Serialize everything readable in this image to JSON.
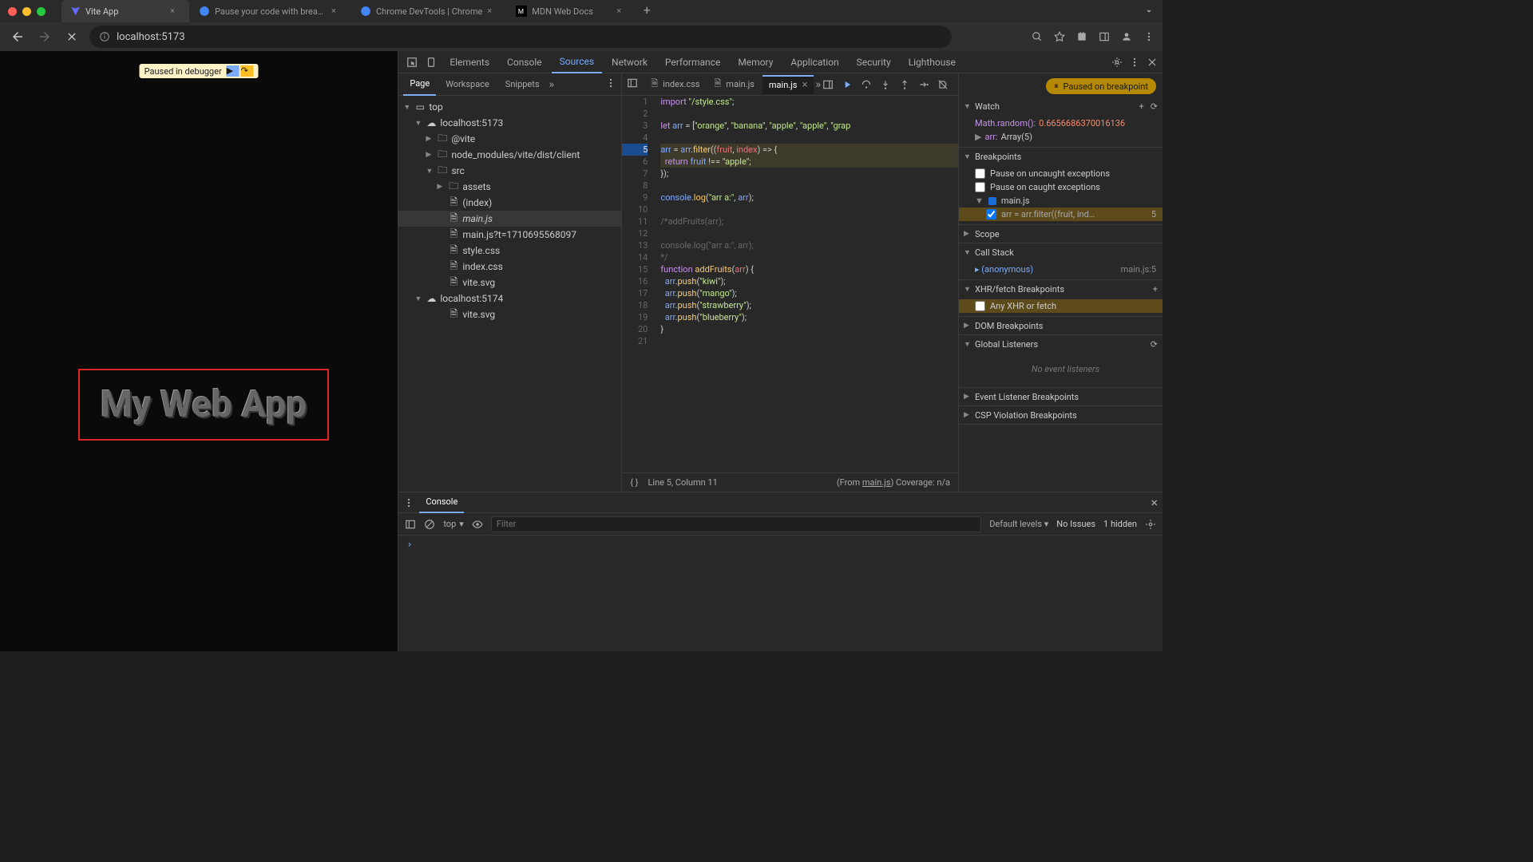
{
  "browser": {
    "tabs": [
      {
        "title": "Vite App",
        "icon": "V"
      },
      {
        "title": "Pause your code with breakp",
        "icon": "C"
      },
      {
        "title": "Chrome DevTools | Chrome",
        "icon": "C"
      },
      {
        "title": "MDN Web Docs",
        "icon": "M"
      }
    ],
    "url": "localhost:5173"
  },
  "viewport": {
    "paused_label": "Paused in debugger",
    "app_heading": "My Web App"
  },
  "devtools": {
    "tabs": [
      "Elements",
      "Console",
      "Sources",
      "Network",
      "Performance",
      "Memory",
      "Application",
      "Security",
      "Lighthouse"
    ],
    "active_tab": "Sources",
    "sources": {
      "subtabs": [
        "Page",
        "Workspace",
        "Snippets"
      ],
      "active_subtab": "Page",
      "tree": {
        "top": "top",
        "host1": "localhost:5173",
        "vite": "@vite",
        "node_modules": "node_modules/vite/dist/client",
        "src": "src",
        "assets": "assets",
        "index": "(index)",
        "main": "main.js",
        "maints": "main.js?t=1710695568097",
        "style": "style.css",
        "indexcss": "index.css",
        "vitesvg": "vite.svg",
        "host2": "localhost:5174",
        "vitesvg2": "vite.svg"
      }
    },
    "editor": {
      "tabs": [
        {
          "name": "index.css"
        },
        {
          "name": "main.js"
        },
        {
          "name": "main.js",
          "active": true
        }
      ],
      "lines": [
        {
          "n": 1,
          "html": "<span class='tk-keyword'>import</span> <span class='tk-string'>\"/style.css\"</span>;"
        },
        {
          "n": 2,
          "html": ""
        },
        {
          "n": 3,
          "html": "<span class='tk-keyword'>let</span> <span class='tk-var'>arr</span> = [<span class='tk-string'>\"orange\"</span>, <span class='tk-string'>\"banana\"</span>, <span class='tk-string'>\"apple\"</span>, <span class='tk-string'>\"apple\"</span>, <span class='tk-string'>\"grap</span>"
        },
        {
          "n": 4,
          "html": ""
        },
        {
          "n": 5,
          "html": "<span class='tk-var'>arr</span> = <span class='tk-var'>arr</span>.<span class='tk-func'>filter</span>((<span class='tk-id'>fruit</span>, <span class='tk-id'>index</span>) =&gt; {",
          "bp": true,
          "hl": true
        },
        {
          "n": 6,
          "html": "  <span class='tk-keyword'>return</span> <span class='tk-var'>fruit</span> !== <span class='tk-string'>\"apple\"</span>;",
          "hl": true
        },
        {
          "n": 7,
          "html": "});"
        },
        {
          "n": 8,
          "html": ""
        },
        {
          "n": 9,
          "html": "<span class='tk-var'>console</span>.<span class='tk-func'>log</span>(<span class='tk-string'>\"arr a:\"</span>, <span class='tk-var'>arr</span>);"
        },
        {
          "n": 10,
          "html": ""
        },
        {
          "n": 11,
          "html": "<span class='tk-comment'>/*addFruits(arr);</span>"
        },
        {
          "n": 12,
          "html": ""
        },
        {
          "n": 13,
          "html": "<span class='tk-comment'>console.log(\"arr a:\", arr);</span>"
        },
        {
          "n": 14,
          "html": "<span class='tk-comment'>*/</span>"
        },
        {
          "n": 15,
          "html": "<span class='tk-keyword'>function</span> <span class='tk-func'>addFruits</span>(<span class='tk-id'>arr</span>) {"
        },
        {
          "n": 16,
          "html": "  <span class='tk-var'>arr</span>.<span class='tk-func'>push</span>(<span class='tk-string'>\"kiwi\"</span>);"
        },
        {
          "n": 17,
          "html": "  <span class='tk-var'>arr</span>.<span class='tk-func'>push</span>(<span class='tk-string'>\"mango\"</span>);"
        },
        {
          "n": 18,
          "html": "  <span class='tk-var'>arr</span>.<span class='tk-func'>push</span>(<span class='tk-string'>\"strawberry\"</span>);"
        },
        {
          "n": 19,
          "html": "  <span class='tk-var'>arr</span>.<span class='tk-func'>push</span>(<span class='tk-string'>\"blueberry\"</span>);"
        },
        {
          "n": 20,
          "html": "}"
        },
        {
          "n": 21,
          "html": ""
        }
      ],
      "status_pos": "Line 5, Column 11",
      "status_from": "(From ",
      "status_file": "main.js",
      "status_coverage": ") Coverage: n/a"
    },
    "debugger": {
      "paused_banner": "Paused on breakpoint",
      "watch_title": "Watch",
      "watch": [
        {
          "name": "Math.random()",
          "val": "0.6656686370016136",
          "type": "num"
        },
        {
          "name": "arr",
          "val": "Array(5)",
          "type": "arr"
        }
      ],
      "breakpoints_title": "Breakpoints",
      "bp_uncaught": "Pause on uncaught exceptions",
      "bp_caught": "Pause on caught exceptions",
      "bp_file": "main.js",
      "bp_code": "arr = arr.filter((fruit, ind…",
      "bp_line": "5",
      "scope_title": "Scope",
      "callstack_title": "Call Stack",
      "stack": [
        {
          "fn": "(anonymous)",
          "loc": "main.js:5"
        }
      ],
      "xhr_title": "XHR/fetch Breakpoints",
      "xhr_any": "Any XHR or fetch",
      "dom_title": "DOM Breakpoints",
      "global_title": "Global Listeners",
      "no_listeners": "No event listeners",
      "evt_title": "Event Listener Breakpoints",
      "csp_title": "CSP Violation Breakpoints"
    },
    "console": {
      "tab": "Console",
      "context": "top",
      "filter_placeholder": "Filter",
      "levels": "Default levels",
      "issues": "No Issues",
      "hidden": "1 hidden"
    }
  }
}
